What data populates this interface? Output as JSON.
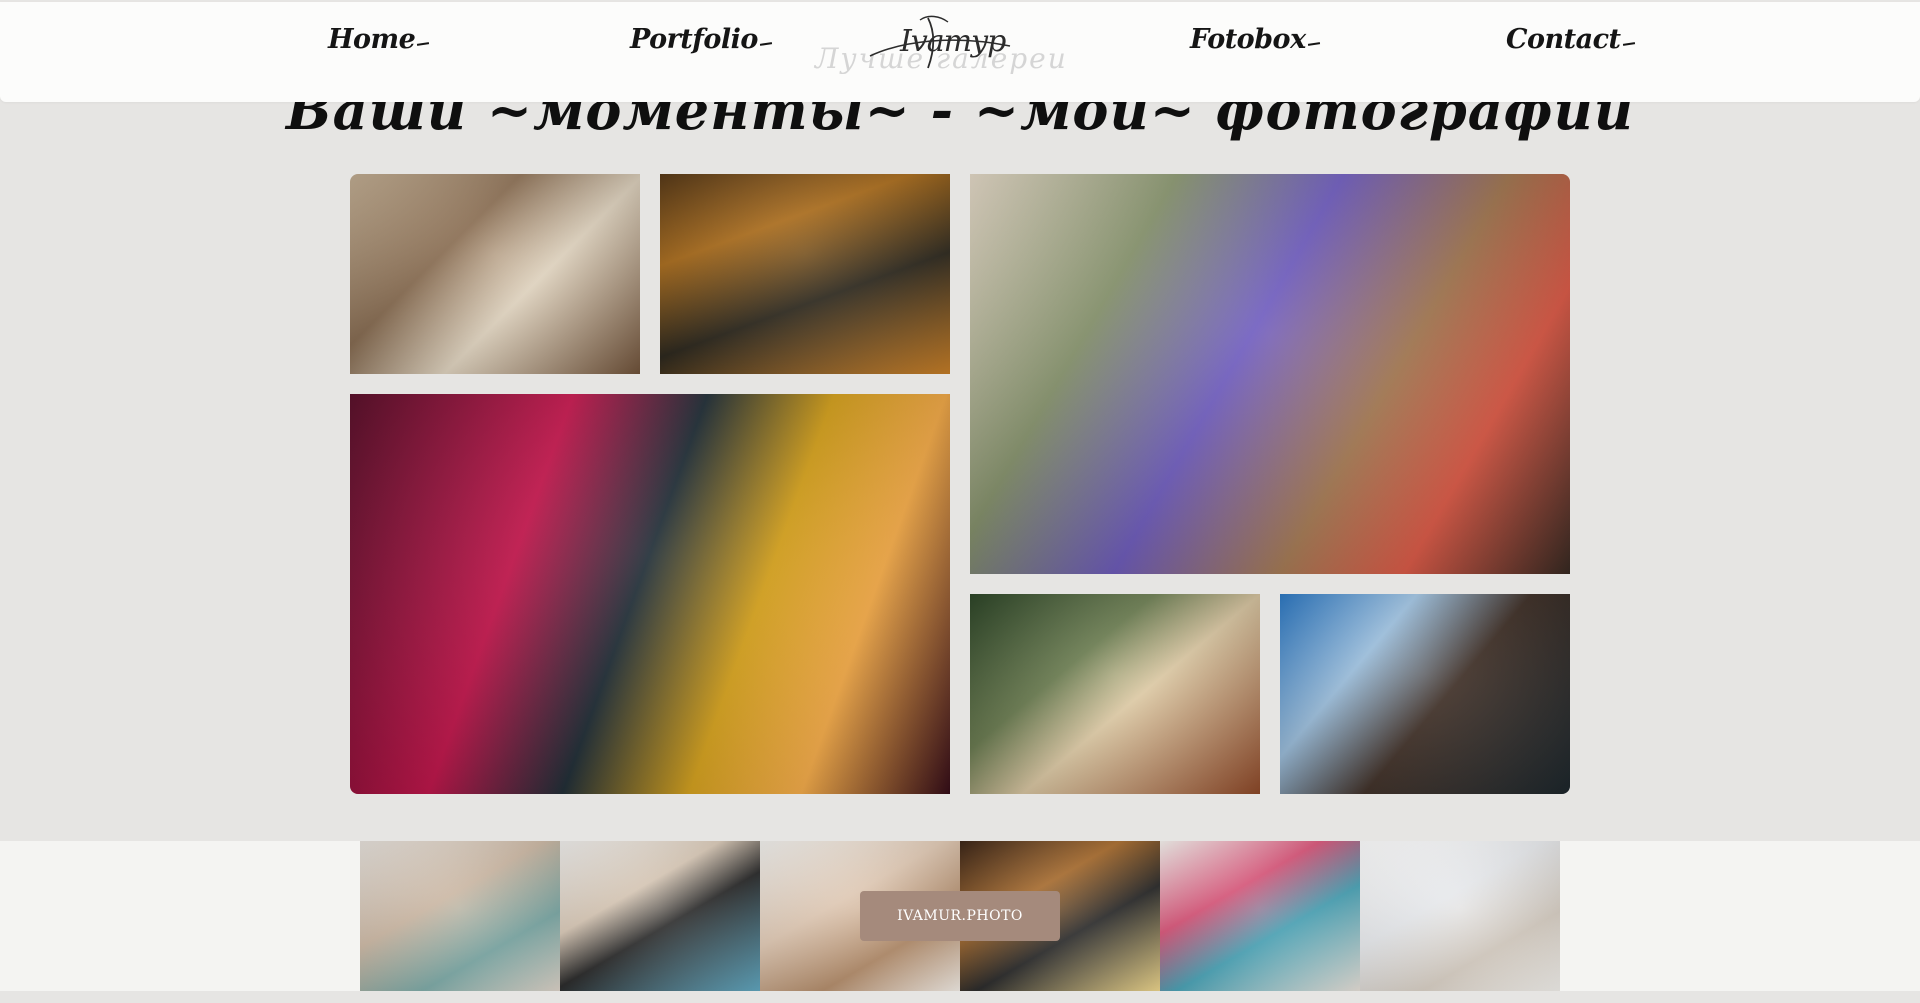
{
  "nav": {
    "home": "Home",
    "portfolio": "Portfolio",
    "fotobox": "Fotobox",
    "contact": "Contact"
  },
  "logo": {
    "script": "Ivamyp",
    "ghost": "Лучше галереи"
  },
  "hero": {
    "title": "Ваши ~моменты~ - ~мои~ фотографии"
  },
  "gallery": {
    "photo_count": 6
  },
  "instagram": {
    "button_label": "IVAMUR.PHOTO",
    "button_color": "#a58a7c",
    "photo_count": 6
  },
  "colors": {
    "page_background": "#e6e5e3",
    "header_background": "#fcfcfb",
    "text": "#151515"
  }
}
